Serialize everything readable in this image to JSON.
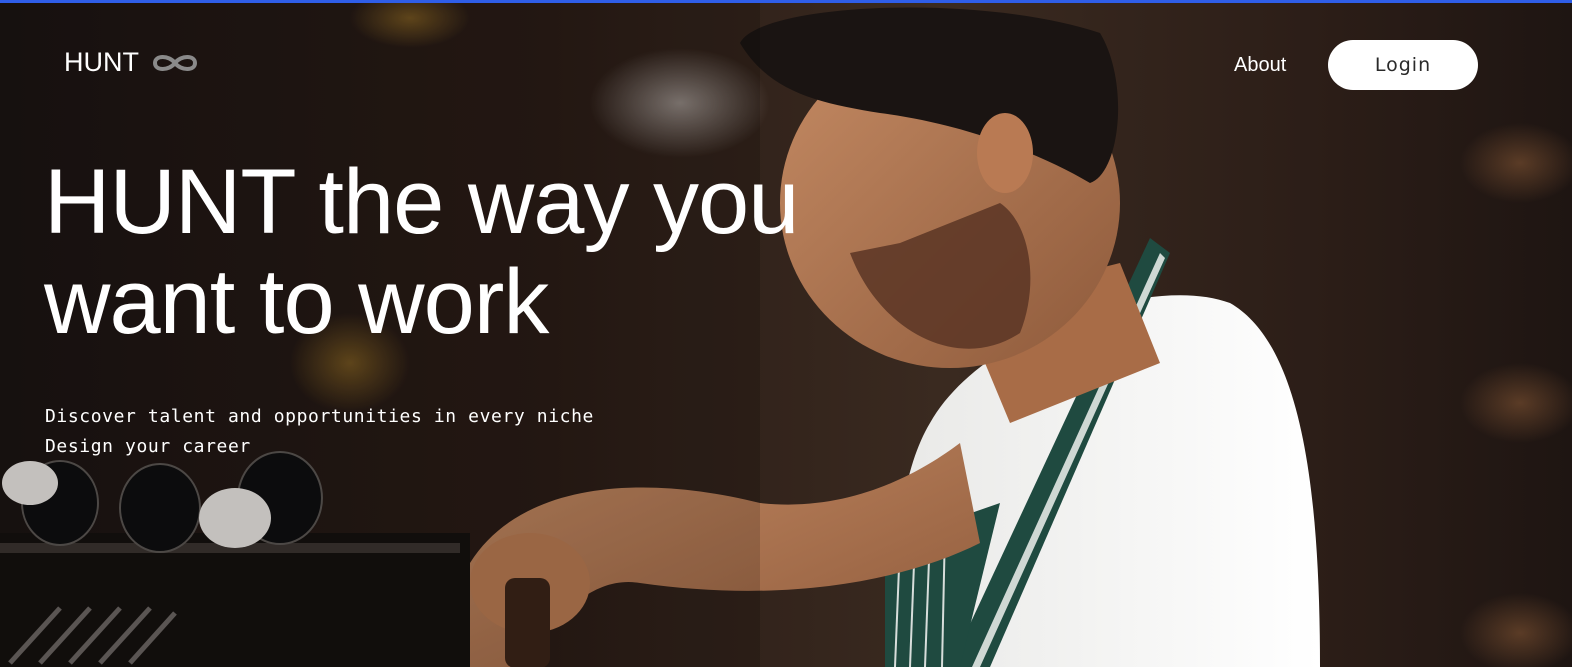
{
  "colors": {
    "accent_bar": "#2f5ee8",
    "text": "#ffffff",
    "login_bg": "#ffffff",
    "login_text": "#2a2a2a"
  },
  "header": {
    "logo_text": "HUNT",
    "logo_icon": "infinity-icon",
    "nav": {
      "about_label": "About"
    },
    "login_label": "Login"
  },
  "hero": {
    "headline_line1": "HUNT the way you",
    "headline_line2": "want to work",
    "sub_line1": "Discover talent and opportunities in every niche",
    "sub_line2": "Design your career",
    "image_description_icon": "barista-photo"
  }
}
